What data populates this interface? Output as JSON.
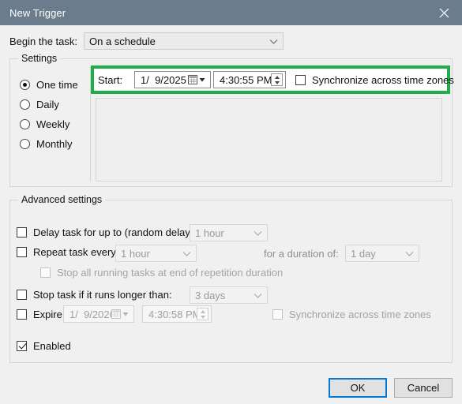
{
  "window": {
    "title": "New Trigger",
    "close_icon": "close-icon"
  },
  "begin": {
    "label": "Begin the task:",
    "value": "On a schedule",
    "chevron_icon": "chevron-down-icon"
  },
  "settings": {
    "group_title": "Settings",
    "schedule_options": [
      {
        "label": "One time",
        "checked": true
      },
      {
        "label": "Daily",
        "checked": false
      },
      {
        "label": "Weekly",
        "checked": false
      },
      {
        "label": "Monthly",
        "checked": false
      }
    ],
    "start_label": "Start:",
    "start_date": "1/  9/2025",
    "start_time": "4:30:55 PM",
    "calendar_icon": "calendar-icon",
    "spinner_icon": "spinner-updown-icon",
    "sync_label": "Synchronize across time zones",
    "sync_checked": false,
    "highlight_color": "#22ac4b"
  },
  "advanced": {
    "group_title": "Advanced settings",
    "delay_label": "Delay task for up to (random delay):",
    "delay_checked": false,
    "delay_value": "1 hour",
    "repeat_label": "Repeat task every:",
    "repeat_checked": false,
    "repeat_value": "1 hour",
    "duration_label": "for a duration of:",
    "duration_value": "1 day",
    "stopall_label": "Stop all running tasks at end of repetition duration",
    "stopall_checked": false,
    "stoptask_label": "Stop task if it runs longer than:",
    "stoptask_checked": false,
    "stoptask_value": "3 days",
    "expire_label": "Expire:",
    "expire_checked": false,
    "expire_date": "1/  9/2026",
    "expire_time": "4:30:58 PM",
    "expire_sync_label": "Synchronize across time zones",
    "expire_sync_checked": false,
    "enabled_label": "Enabled",
    "enabled_checked": true
  },
  "buttons": {
    "ok": "OK",
    "cancel": "Cancel"
  }
}
